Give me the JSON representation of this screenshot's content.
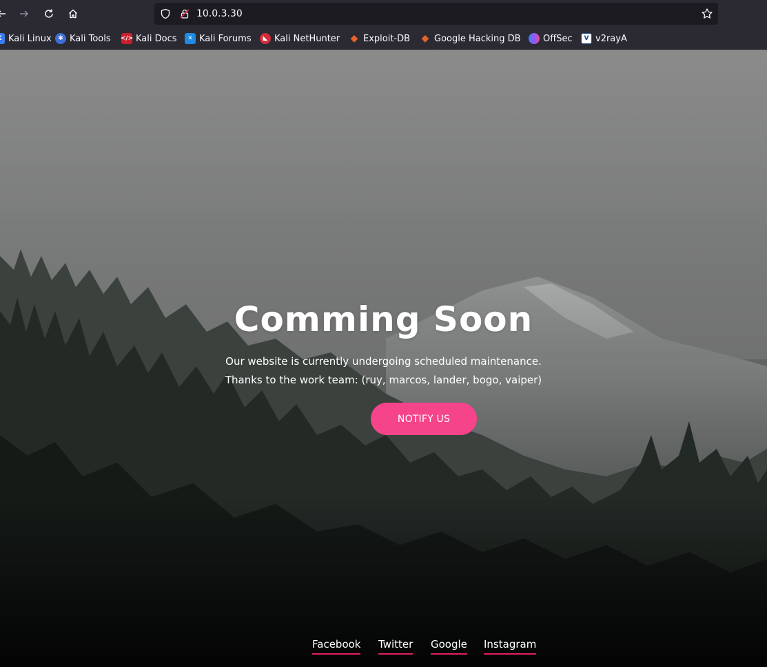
{
  "browser": {
    "url": "10.0.3.30",
    "bookmarks": [
      {
        "label": "Kali Linux",
        "icon": "kali-linux-icon"
      },
      {
        "label": "Kali Tools",
        "icon": "kali-tools-icon"
      },
      {
        "label": "Kali Docs",
        "icon": "kali-docs-icon"
      },
      {
        "label": "Kali Forums",
        "icon": "kali-forums-icon"
      },
      {
        "label": "Kali NetHunter",
        "icon": "kali-nethunter-icon"
      },
      {
        "label": "Exploit-DB",
        "icon": "exploit-db-icon"
      },
      {
        "label": "Google Hacking DB",
        "icon": "google-hacking-db-icon"
      },
      {
        "label": "OffSec",
        "icon": "offsec-icon"
      },
      {
        "label": "v2rayA",
        "icon": "v2raya-icon"
      }
    ]
  },
  "hero": {
    "title": "Comming Soon",
    "line1": "Our website is currently undergoing scheduled maintenance.",
    "line2": "Thanks to the work team: (ruy, marcos, lander, bogo, vaiper)",
    "button": "NOTIFY US"
  },
  "social": [
    "Facebook",
    "Twitter",
    "Google",
    "Instagram"
  ],
  "colors": {
    "accent": "#f5448a",
    "underline": "#e02060",
    "toolbar": "#2b2a33",
    "urlbar": "#1c1b22"
  }
}
